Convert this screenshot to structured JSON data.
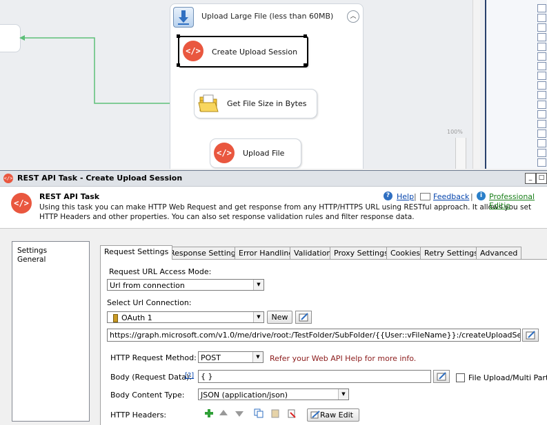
{
  "designer": {
    "container_title": "Upload Large File (less than 60MB)",
    "tasks": [
      {
        "label": "Create Upload Session"
      },
      {
        "label": "Get File Size in Bytes"
      },
      {
        "label": "Upload File"
      }
    ],
    "zoom_label": "100%",
    "icons": {
      "container": "download-arrow-icon",
      "rest": "code-brackets-icon",
      "folder": "folder-icon",
      "collapse": "chevron-up-icon"
    },
    "colors": {
      "rest_icon": "#e9573f",
      "connector": "#5cbf78",
      "panel_border": "#27406b"
    }
  },
  "dialog": {
    "title": "REST API Task - Create Upload Session",
    "window_buttons": {
      "minimize": "_",
      "restore": "□"
    },
    "header": {
      "title": "REST API Task",
      "description": "Using this task you can make HTTP Web Request and get response from any HTTP/HTTPS URL using RESTful approach. It allows you set HTTP Headers and other properties. You can also set response validation rules and filter response data.",
      "help": "Help",
      "feedback": "Feedback",
      "edition": "Professional Editio"
    },
    "tree": [
      "Settings",
      "General"
    ],
    "tabs": [
      "Request Settings",
      "Response Settings",
      "Error Handling",
      "Validation",
      "Proxy Settings",
      "Cookies",
      "Retry Settings",
      "Advanced"
    ],
    "active_tab": "Request Settings",
    "form": {
      "access_mode_label": "Request URL Access Mode:",
      "access_mode_value": "Url from connection",
      "url_connection_label": "Select Url Connection:",
      "url_connection_value": "OAuth 1",
      "new_button": "New",
      "url_value": "https://graph.microsoft.com/v1.0/me/drive/root:/TestFolder/SubFolder/{{User::vFileName}}:/createUploadSession",
      "method_label": "HTTP Request Method:",
      "method_value": "POST",
      "method_hint": "Refer your Web API Help for more info.",
      "body_label": "Body (Request Data):",
      "body_help": "[?]",
      "body_value": "{ }",
      "file_upload_label": "File Upload/Multi Part",
      "content_type_label": "Body Content Type:",
      "content_type_value": "JSON (application/json)",
      "headers_label": "HTTP Headers:",
      "raw_edit_button": "Raw Edit"
    }
  }
}
